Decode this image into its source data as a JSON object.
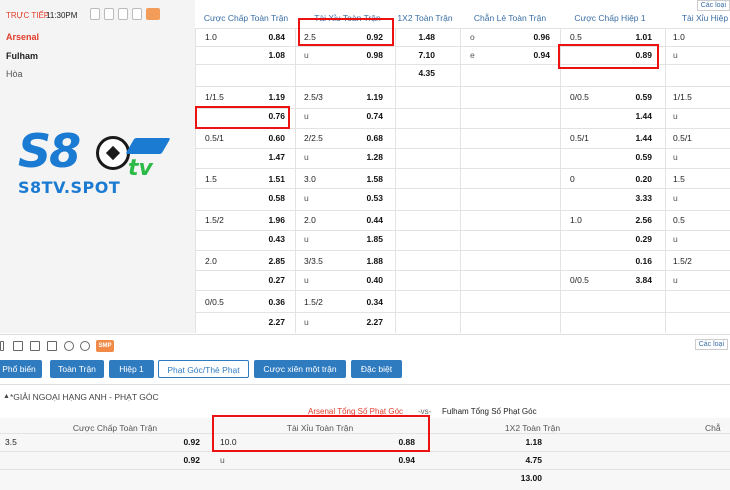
{
  "header": {
    "live_label": "TRỰC TIẾP",
    "time": "11:30PM",
    "columns": [
      "Cược Chấp Toàn Trận",
      "Tài Xỉu Toàn Trận",
      "1X2 Toàn Trận",
      "Chẵn Lẻ Toàn Trận",
      "Cược Chấp Hiệp 1",
      "Tài Xỉu Hiệp"
    ],
    "corner_button": "Các loại"
  },
  "teams": {
    "home": "Arsenal",
    "away": "Fulham",
    "draw": "Hòa"
  },
  "logo": {
    "main": "S8",
    "tv": "tv",
    "sub": "S8TV.SPOT"
  },
  "main_rows": [
    {
      "hcap": {
        "l1": "1.0",
        "v1": "0.84",
        "l2": "",
        "v2": "1.08"
      },
      "ou": {
        "l1": "2.5",
        "v1": "0.92",
        "l2": "u",
        "v2": "0.98"
      },
      "x12": {
        "v1": "1.48",
        "v2": "7.10",
        "v3": "4.35"
      },
      "oe": {
        "l1": "o",
        "v1": "0.96",
        "l2": "e",
        "v2": "0.94"
      },
      "h1": {
        "l1": "0.5",
        "v1": "1.01",
        "l2": "",
        "v2": "0.89"
      },
      "ou1": {
        "l1": "1.0",
        "l2": "u"
      }
    }
  ],
  "rows": [
    {
      "hc_l": "1/1.5",
      "hc_v1": "1.19",
      "hc_v2": "0.76",
      "ou_l": "2.5/3",
      "ou_v1": "1.19",
      "ou_v2": "0.74",
      "h1_l": "0/0.5",
      "h1_v1": "0.59",
      "h1_v2": "1.44",
      "ou1_l": "1/1.5"
    },
    {
      "hc_l": "0.5/1",
      "hc_v1": "0.60",
      "hc_v2": "1.47",
      "ou_l": "2/2.5",
      "ou_v1": "0.68",
      "ou_v2": "1.28",
      "h1_l": "0.5/1",
      "h1_v1": "1.44",
      "h1_v2": "0.59",
      "ou1_l": "0.5/1"
    },
    {
      "hc_l": "1.5",
      "hc_v1": "1.51",
      "hc_v2": "0.58",
      "ou_l": "3.0",
      "ou_v1": "1.58",
      "ou_v2": "0.53",
      "h1_l": "0",
      "h1_v1": "0.20",
      "h1_v2": "3.33",
      "ou1_l": "1.5"
    },
    {
      "hc_l": "1.5/2",
      "hc_v1": "1.96",
      "hc_v2": "0.43",
      "ou_l": "2.0",
      "ou_v1": "0.44",
      "ou_v2": "1.85",
      "h1_l": "1.0",
      "h1_v1": "2.56",
      "h1_v2": "0.29",
      "ou1_l": "0.5"
    },
    {
      "hc_l": "2.0",
      "hc_v1": "2.85",
      "hc_v2": "0.27",
      "ou_l": "3/3.5",
      "ou_v1": "1.88",
      "ou_v2": "0.40",
      "h1_l": "",
      "h1_v1": "0.16",
      "h1_v2": "3.84",
      "h1_l2": "0/0.5",
      "ou1_l": "1.5/2"
    },
    {
      "hc_l": "0/0.5",
      "hc_v1": "0.36",
      "hc_v2": "2.27",
      "ou_l": "1.5/2",
      "ou_v1": "0.34",
      "ou_v2": "2.27",
      "h1_l": "",
      "h1_v1": "",
      "h1_v2": "",
      "ou1_l": ""
    }
  ],
  "toolbar": {
    "smp": "SMP",
    "right": "Các loại"
  },
  "tabs": [
    "Phổ biến",
    "Toàn Trận",
    "Hiệp 1",
    "Phạt Góc/Thẻ Phạt",
    "Cược xiên một trận",
    "Đặc biệt"
  ],
  "league": "*GIẢI NGOẠI HẠNG ANH - PHẠT GÓC",
  "match": {
    "home": "Arsenal Tổng Số Phạt Góc",
    "vs": "-vs-",
    "away": "Fulham Tổng Số Phạt Góc"
  },
  "bottom": {
    "columns": [
      "Cược Chấp Toàn Trận",
      "Tài Xỉu Toàn Trận",
      "1X2 Toàn Trận",
      "Chẵ"
    ],
    "rows": [
      {
        "hc_l": "3.5",
        "hc_v": "0.92",
        "ou_l": "10.0",
        "ou_v": "0.88",
        "x12": "1.18"
      },
      {
        "hc_l": "",
        "hc_v": "0.92",
        "ou_l": "u",
        "ou_v": "0.94",
        "x12": "4.75"
      },
      {
        "hc_l": "",
        "hc_v": "",
        "ou_l": "",
        "ou_v": "",
        "x12": "13.00"
      }
    ]
  }
}
